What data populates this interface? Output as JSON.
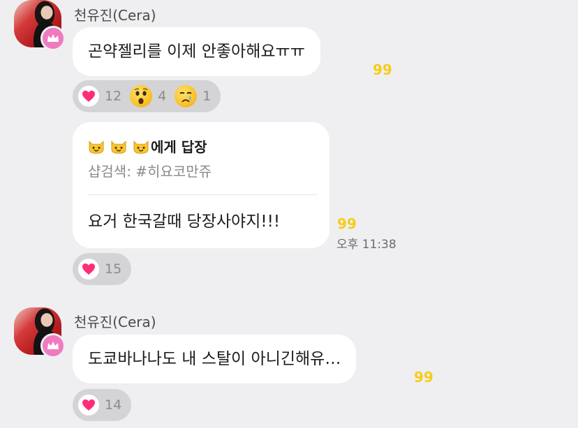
{
  "messages": [
    {
      "sender": "천유진(Cera)",
      "text": "곤약젤리를 이제 안좋아해요ㅠㅠ",
      "count": "99",
      "reactions": [
        {
          "icon": "heart-icon",
          "count": "12"
        },
        {
          "icon": "surprised-emoji-icon",
          "count": "4"
        },
        {
          "icon": "sad-emoji-icon",
          "count": "1"
        }
      ]
    },
    {
      "reply_to_label": "에게 답장",
      "reply_quote": "샵검색: #히요코만쥬",
      "text": "요거 한국갈때 당장사야지!!!",
      "count": "99",
      "time": "오후 11:38",
      "reactions": [
        {
          "icon": "heart-icon",
          "count": "15"
        }
      ]
    },
    {
      "sender": "천유진(Cera)",
      "text": "도쿄바나나도 내 스탈이 아니긴해유…",
      "count": "99",
      "reactions": [
        {
          "icon": "heart-icon",
          "count": "14"
        }
      ]
    }
  ],
  "colors": {
    "background": "#efeff1",
    "bubble": "#ffffff",
    "count_yellow": "#f5cd1a",
    "heart_pink": "#ff2d79",
    "crown_badge": "#f07ac0"
  }
}
